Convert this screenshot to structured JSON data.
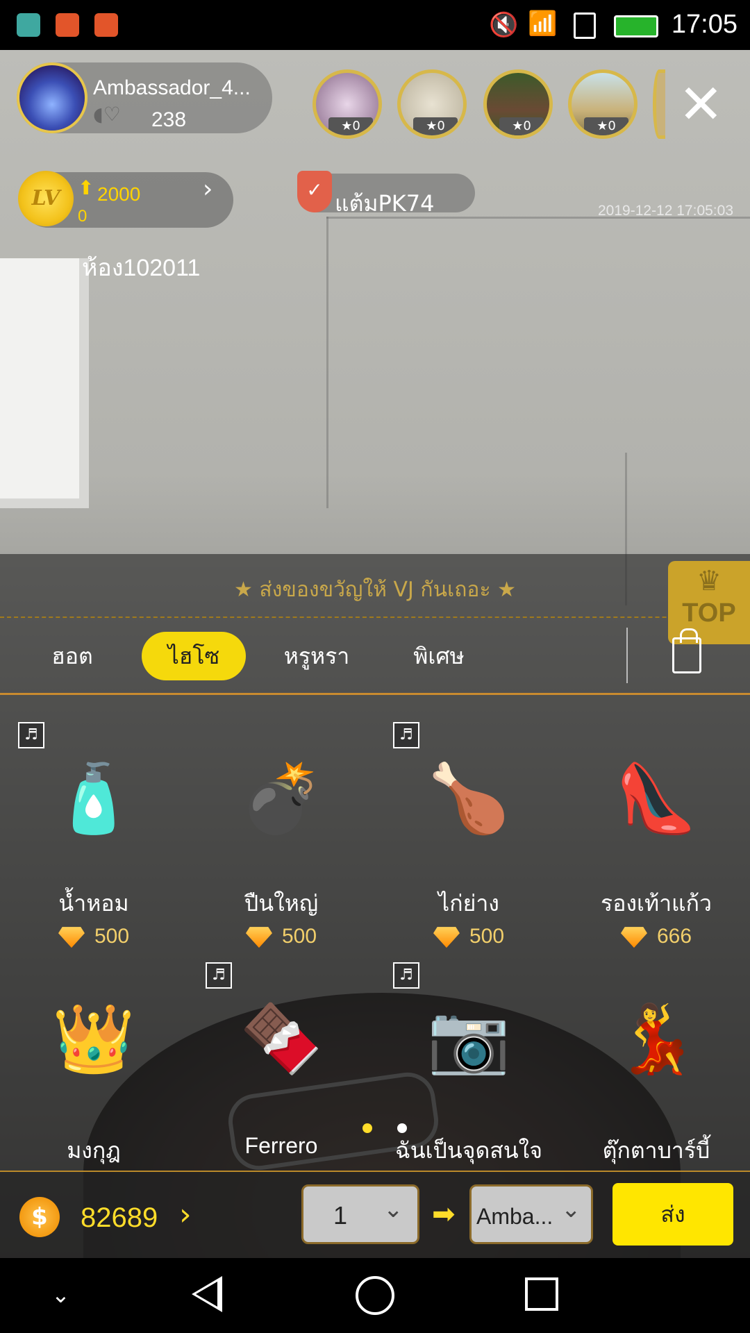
{
  "status_bar": {
    "time": "17:05",
    "apps": [
      "android-icon",
      "music-icon",
      "music-icon"
    ],
    "icons": [
      "mute-icon",
      "wifi-icon",
      "sim-icon",
      "battery-icon"
    ]
  },
  "host": {
    "name": "Ambassador_4...",
    "likes": "238"
  },
  "viewers": [
    {
      "badge": "★0"
    },
    {
      "badge": "★0"
    },
    {
      "badge": "★0"
    },
    {
      "badge": "★0"
    }
  ],
  "level": {
    "coin_label": "LV",
    "score": "2000",
    "progress": "0"
  },
  "pk": {
    "label": "แต้มPK74"
  },
  "timestamp": "2019-12-12 17:05:03",
  "room_text": "ห้อง102011",
  "gift_panel": {
    "banner": "★  ส่งของขวัญให้ VJ กันเถอะ  ★",
    "top_badge": "TOP",
    "tabs": [
      {
        "label": "ฮอต"
      },
      {
        "label": "ไฮโซ"
      },
      {
        "label": "หรูหรา"
      },
      {
        "label": "พิเศษ"
      }
    ],
    "active_tab": "ไฮโซ",
    "gifts": [
      {
        "name": "น้ำหอม",
        "price": "500",
        "mic": true,
        "icon": "perfume-icon"
      },
      {
        "name": "ปืนใหญ่",
        "price": "500",
        "mic": false,
        "icon": "cannon-icon"
      },
      {
        "name": "ไก่ย่าง",
        "price": "500",
        "mic": true,
        "icon": "roast-chicken-icon"
      },
      {
        "name": "รองเท้าแก้ว",
        "price": "666",
        "mic": false,
        "icon": "glass-slipper-icon"
      },
      {
        "name": "มงกุฎ",
        "price": "",
        "mic": false,
        "icon": "crown-icon"
      },
      {
        "name": "Ferrero",
        "price": "",
        "mic": true,
        "icon": "chocolate-box-icon"
      },
      {
        "name": "ฉันเป็นจุดสนใจ",
        "price": "",
        "mic": true,
        "icon": "camera-icon"
      },
      {
        "name": "ตุ๊กตาบาร์บี้",
        "price": "",
        "mic": false,
        "icon": "doll-icon"
      }
    ]
  },
  "send_bar": {
    "balance": "82689",
    "quantity": "1",
    "recipient": "Amba...",
    "send_label": "ส่ง"
  },
  "colors": {
    "accent_yellow": "#f5d90c",
    "gold": "#c9a84a",
    "tab_line": "#c98b2f"
  }
}
